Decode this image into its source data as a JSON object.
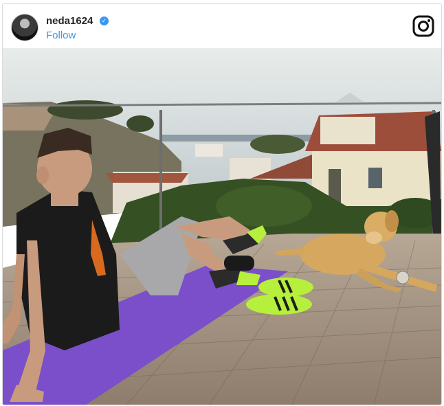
{
  "post": {
    "username": "neda1624",
    "follow_label": "Follow",
    "verified_icon": "verified-badge-icon",
    "brand_icon": "instagram-icon"
  },
  "photo": {
    "description_alt": "Man in black shirt and grey shorts stretching on a purple yoga mat on a wooden terrace next to a golden retriever, with green slides and sea view houses behind"
  },
  "colors": {
    "link_blue": "#3897f0",
    "text_dark": "#262626",
    "mat_purple": "#7b4fc9",
    "slide_green": "#b6ef3c"
  }
}
